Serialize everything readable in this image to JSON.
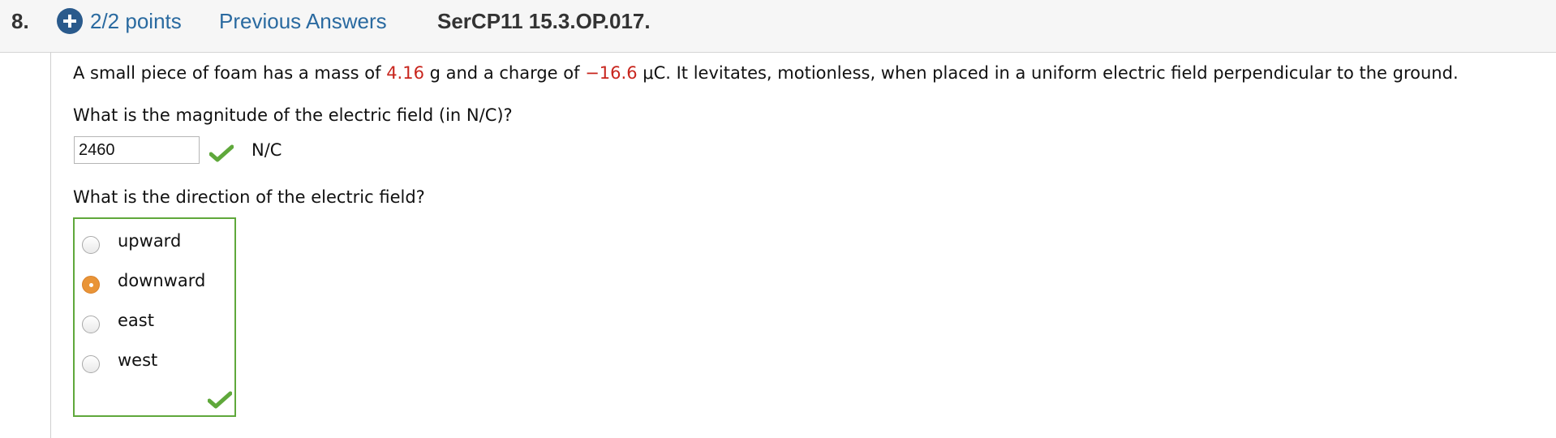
{
  "header": {
    "question_number": "8.",
    "points": "2/2 points",
    "previous_answers": "Previous Answers",
    "question_code": "SerCP11 15.3.OP.017."
  },
  "problem": {
    "part1": "A small piece of foam has a mass of ",
    "mass": "4.16",
    "part2": " g and a charge of ",
    "charge": "−16.6",
    "part3": " μC. It levitates, motionless, when placed in a uniform electric field perpendicular to the ground."
  },
  "question1": {
    "prompt": "What is the magnitude of the electric field (in N/C)?",
    "answer": "2460",
    "unit": "N/C"
  },
  "question2": {
    "prompt": "What is the direction of the electric field?",
    "options": [
      "upward",
      "downward",
      "east",
      "west"
    ],
    "selected": "downward"
  },
  "colors": {
    "link": "#2a6aa0",
    "plus_badge": "#2a5a8c",
    "highlight": "#c8251d",
    "correct": "#5fa83b",
    "selected_radio": "#e99437"
  },
  "icons": {
    "points_badge": "plus-icon",
    "correct_mark": "checkmark-icon"
  }
}
